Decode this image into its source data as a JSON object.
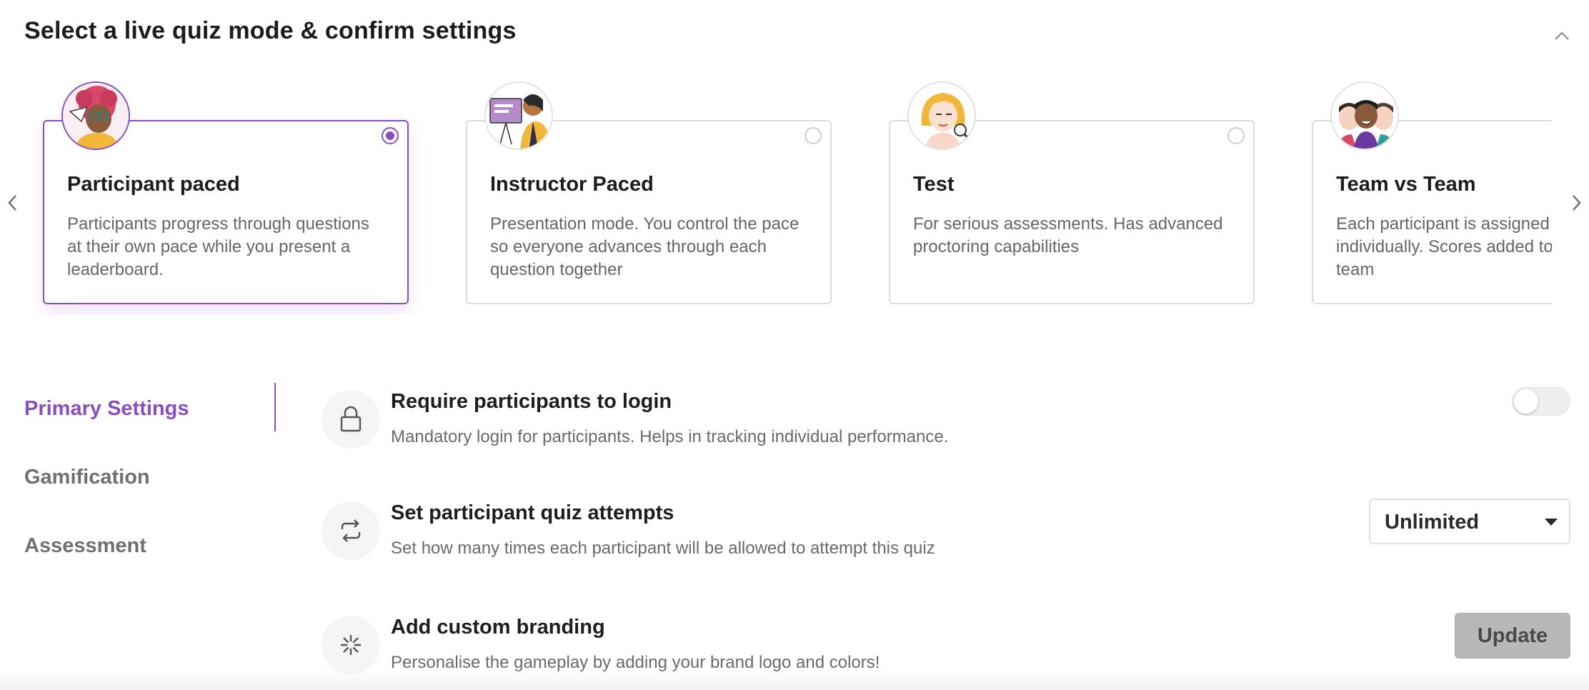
{
  "header": {
    "title": "Select a live quiz mode & confirm settings",
    "collapse_icon": "chevron-up-icon"
  },
  "carousel": {
    "prev_icon": "chevron-left-icon",
    "next_icon": "chevron-right-icon",
    "modes": [
      {
        "title": "Participant paced",
        "description": "Participants progress through questions at their own pace while you present a leaderboard.",
        "selected": true,
        "avatar": "participant-paced-illustration"
      },
      {
        "title": "Instructor Paced",
        "description": "Presentation mode. You control the pace so everyone advances through each question together",
        "selected": false,
        "avatar": "instructor-paced-illustration"
      },
      {
        "title": "Test",
        "description": "For serious assessments. Has advanced proctoring capabilities",
        "selected": false,
        "avatar": "test-illustration"
      },
      {
        "title": "Team vs Team",
        "description": "Each participant is assigned and plays individually. Scores added together to get team",
        "selected": false,
        "avatar": "team-vs-team-illustration"
      }
    ]
  },
  "settings_nav": {
    "items": [
      {
        "label": "Primary Settings",
        "active": true
      },
      {
        "label": "Gamification",
        "active": false
      },
      {
        "label": "Assessment",
        "active": false
      }
    ]
  },
  "settings": {
    "login": {
      "title": "Require participants to login",
      "description": "Mandatory login for participants. Helps in tracking individual performance.",
      "icon": "lock-icon",
      "enabled": false
    },
    "attempts": {
      "title": "Set participant quiz attempts",
      "description": "Set how many times each participant will be allowed to attempt this quiz",
      "icon": "repeat-icon",
      "selected_value": "Unlimited"
    },
    "branding": {
      "title": "Add custom branding",
      "description": "Personalise the gameplay by adding your brand logo and colors!",
      "icon": "sparkle-icon",
      "button_label": "Update"
    }
  },
  "colors": {
    "accent": "#8a4fbf",
    "border": "#dcdcdc",
    "muted_text": "#666666",
    "disabled_button": "#b8b8b8"
  }
}
